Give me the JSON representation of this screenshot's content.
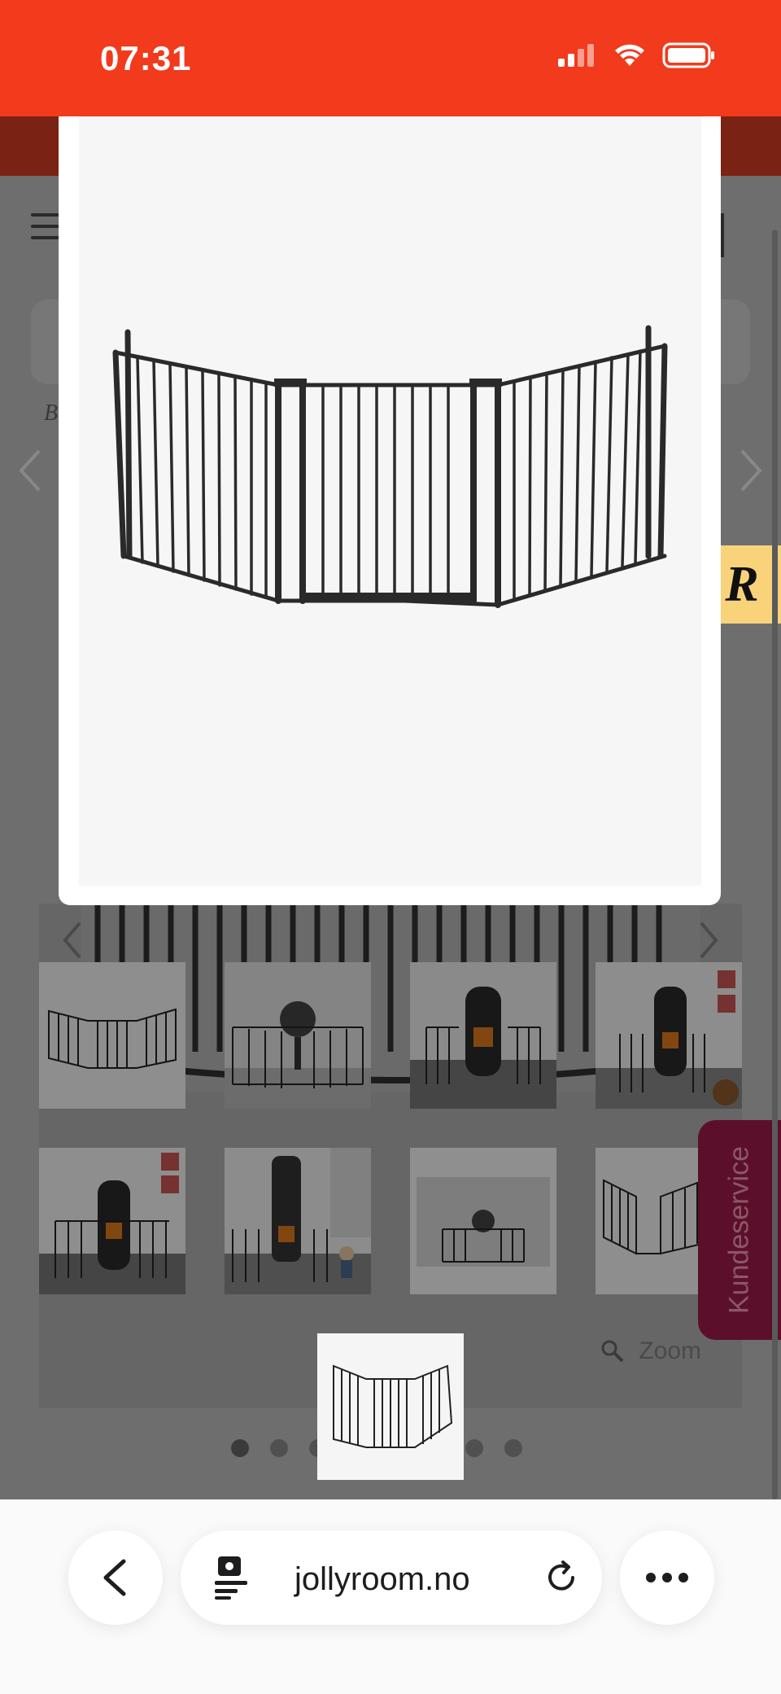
{
  "status_bar": {
    "time": "07:31"
  },
  "site": {
    "breadcrumb_fragment": "B",
    "zoom_label": "Zoom",
    "gallery_dots": 9,
    "gallery_active_dot": 0
  },
  "side_widgets": {
    "reviews_badge": "R",
    "support_tab": "Kundeservice"
  },
  "browser": {
    "url": "jollyroom.no"
  },
  "thumbnails": [
    {
      "scene": "fence-white"
    },
    {
      "scene": "fence-grill"
    },
    {
      "scene": "fence-stove"
    },
    {
      "scene": "fence-stove-corner"
    },
    {
      "scene": "fence-stove-room"
    },
    {
      "scene": "fence-stove-child"
    },
    {
      "scene": "fence-grill-wide"
    },
    {
      "scene": "fence-open"
    },
    {
      "scene": "fence-extended"
    }
  ],
  "colors": {
    "status_bar": "#f23a1c",
    "overlay": "#6b6b6b",
    "reviews_badge": "#f8d37a",
    "support_tab": "#5c0f2b"
  },
  "icons": [
    "signal-icon",
    "wifi-icon",
    "battery-icon",
    "hamburger-menu-icon",
    "chevron-left-icon",
    "chevron-right-icon",
    "search-zoom-icon",
    "back-icon",
    "site-settings-icon",
    "reload-icon",
    "more-icon"
  ]
}
